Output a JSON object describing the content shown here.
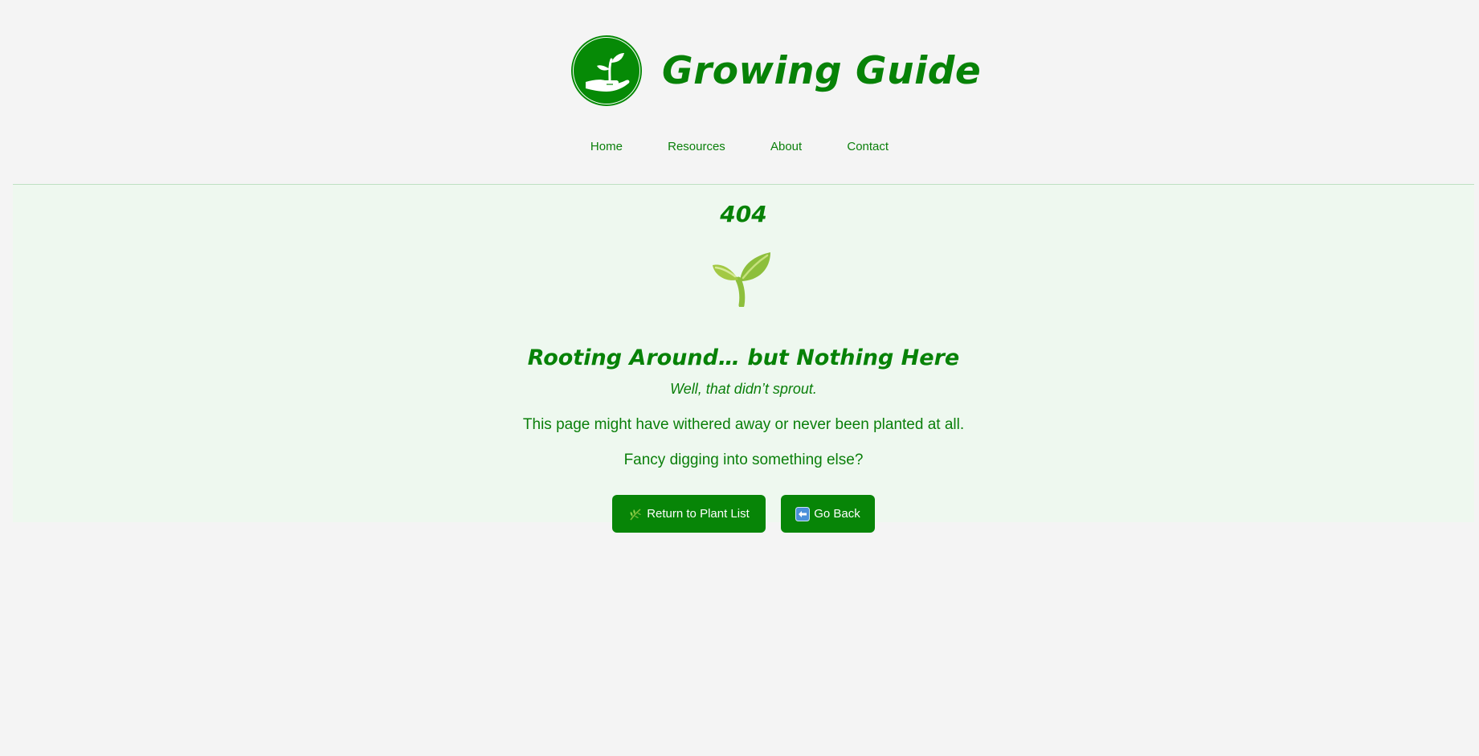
{
  "header": {
    "title": "Growing Guide",
    "logo_icon": "hand-holding-seedling-icon"
  },
  "nav": {
    "items": [
      "Home",
      "Resources",
      "About",
      "Contact"
    ]
  },
  "error": {
    "code": "404",
    "illustration_icon": "seedling-icon",
    "headline": "Rooting Around… but Nothing Here",
    "subline": "Well, that didn’t sprout.",
    "message": "This page might have withered away or never been planted at all.",
    "prompt": "Fancy digging into something else?"
  },
  "actions": {
    "return_icon": "herb-icon",
    "return_label": "Return to Plant List",
    "back_icon": "back-arrow-icon",
    "back_label": "Go Back"
  },
  "colors": {
    "brand_green": "#078207",
    "page_bg": "#f4f4f4",
    "panel_bg": "#eef8ef",
    "button_bg": "#078507",
    "button_text": "#ffffff"
  }
}
